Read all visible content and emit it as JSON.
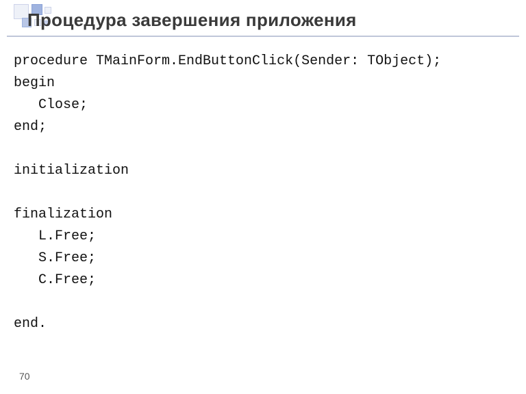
{
  "slide": {
    "title": "Процедура завершения приложения",
    "page_number": "70"
  },
  "code": {
    "l1": "procedure TMainForm.EndButtonClick(Sender: TObject);",
    "l2": "begin",
    "l3": "   Close;",
    "l4": "end;",
    "l5": "",
    "l6": "initialization",
    "l7": "",
    "l8": "finalization",
    "l9": "   L.Free;",
    "l10": "   S.Free;",
    "l11": "   C.Free;",
    "l12": "",
    "l13": "end."
  }
}
